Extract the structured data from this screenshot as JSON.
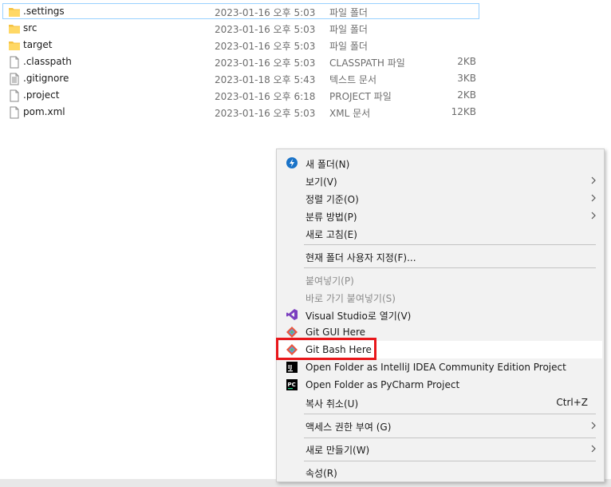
{
  "files": [
    {
      "name": ".settings",
      "date": "2023-01-16 오후 5:03",
      "type": "파일 폴더",
      "size": "",
      "icon": "folder-icon"
    },
    {
      "name": "src",
      "date": "2023-01-16 오후 5:03",
      "type": "파일 폴더",
      "size": "",
      "icon": "folder-icon"
    },
    {
      "name": "target",
      "date": "2023-01-16 오후 5:03",
      "type": "파일 폴더",
      "size": "",
      "icon": "folder-icon"
    },
    {
      "name": ".classpath",
      "date": "2023-01-16 오후 5:03",
      "type": "CLASSPATH 파일",
      "size": "2KB",
      "icon": "file-icon"
    },
    {
      "name": ".gitignore",
      "date": "2023-01-18 오후 5:43",
      "type": "텍스트 문서",
      "size": "3KB",
      "icon": "text-file-icon"
    },
    {
      "name": ".project",
      "date": "2023-01-16 오후 6:18",
      "type": "PROJECT 파일",
      "size": "2KB",
      "icon": "file-icon"
    },
    {
      "name": "pom.xml",
      "date": "2023-01-16 오후 5:03",
      "type": "XML 문서",
      "size": "12KB",
      "icon": "file-icon"
    }
  ],
  "context_menu": {
    "new_folder": "새 폴더(N)",
    "view": "보기(V)",
    "sort_by": "정렬 기준(O)",
    "group_by": "분류 방법(P)",
    "refresh": "새로 고침(E)",
    "customize_folder": "현재 폴더 사용자 지정(F)...",
    "paste": "붙여넣기(P)",
    "paste_shortcut": "바로 가기 붙여넣기(S)",
    "open_visual_studio": "Visual Studio로 열기(V)",
    "git_gui": "Git GUI Here",
    "git_bash": "Git Bash Here",
    "open_intellij": "Open Folder as IntelliJ IDEA Community Edition Project",
    "open_pycharm": "Open Folder as PyCharm Project",
    "undo_copy": "복사 취소(U)",
    "undo_copy_shortcut": "Ctrl+Z",
    "grant_access": "액세스 권한 부여 (G)",
    "new": "새로 만들기(W)",
    "properties": "속성(R)"
  },
  "colors": {
    "highlight_border": "#e8171b",
    "selection_border": "#99d1ff",
    "folder": "#f5c242",
    "disabled_text": "#8c8c8c"
  }
}
